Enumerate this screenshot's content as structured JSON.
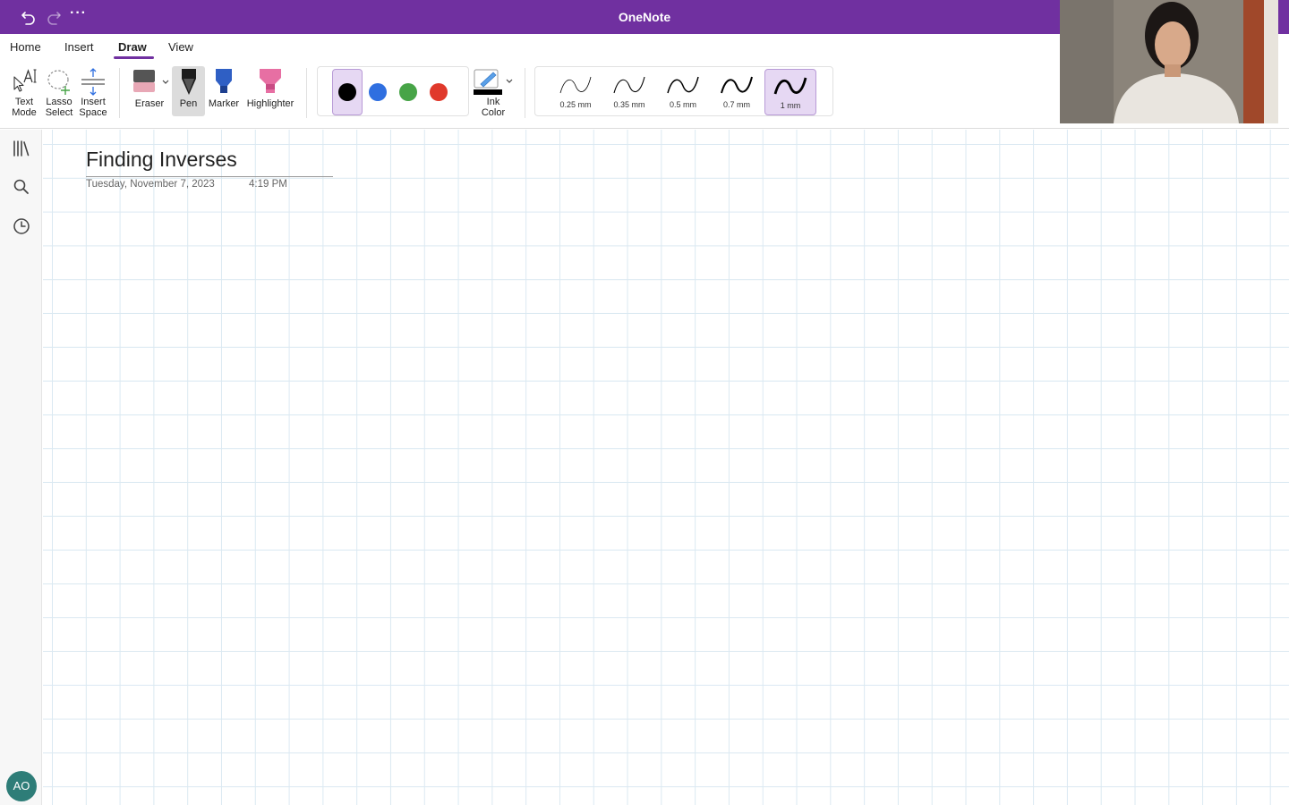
{
  "app": {
    "title": "OneNote",
    "brand_color": "#7030a0"
  },
  "titlebar": {
    "undo_icon": "undo-icon",
    "redo_icon": "redo-icon",
    "more_label": "···"
  },
  "tabs": [
    {
      "label": "Home"
    },
    {
      "label": "Insert"
    },
    {
      "label": "Draw",
      "active": true
    },
    {
      "label": "View"
    }
  ],
  "toolbar": {
    "text_mode": {
      "line1": "Text",
      "line2": "Mode"
    },
    "lasso_select": {
      "line1": "Lasso",
      "line2": "Select"
    },
    "insert_space": {
      "line1": "Insert",
      "line2": "Space"
    },
    "eraser": "Eraser",
    "pen": "Pen",
    "marker": "Marker",
    "highlighter": "Highlighter",
    "ink_color": {
      "line1": "Ink",
      "line2": "Color"
    },
    "colors": [
      "#000000",
      "#2f6fe0",
      "#47a447",
      "#e0392b"
    ],
    "selected_color": "#000000",
    "widths": [
      "0.25 mm",
      "0.35 mm",
      "0.5 mm",
      "0.7 mm",
      "1 mm"
    ],
    "selected_width": "1 mm"
  },
  "rail": {
    "notebooks_icon": "notebooks-icon",
    "search_icon": "search-icon",
    "recent_icon": "clock-icon",
    "avatar_initials": "AO"
  },
  "page": {
    "title": "Finding Inverses",
    "date": "Tuesday, November 7, 2023",
    "time": "4:19 PM"
  }
}
